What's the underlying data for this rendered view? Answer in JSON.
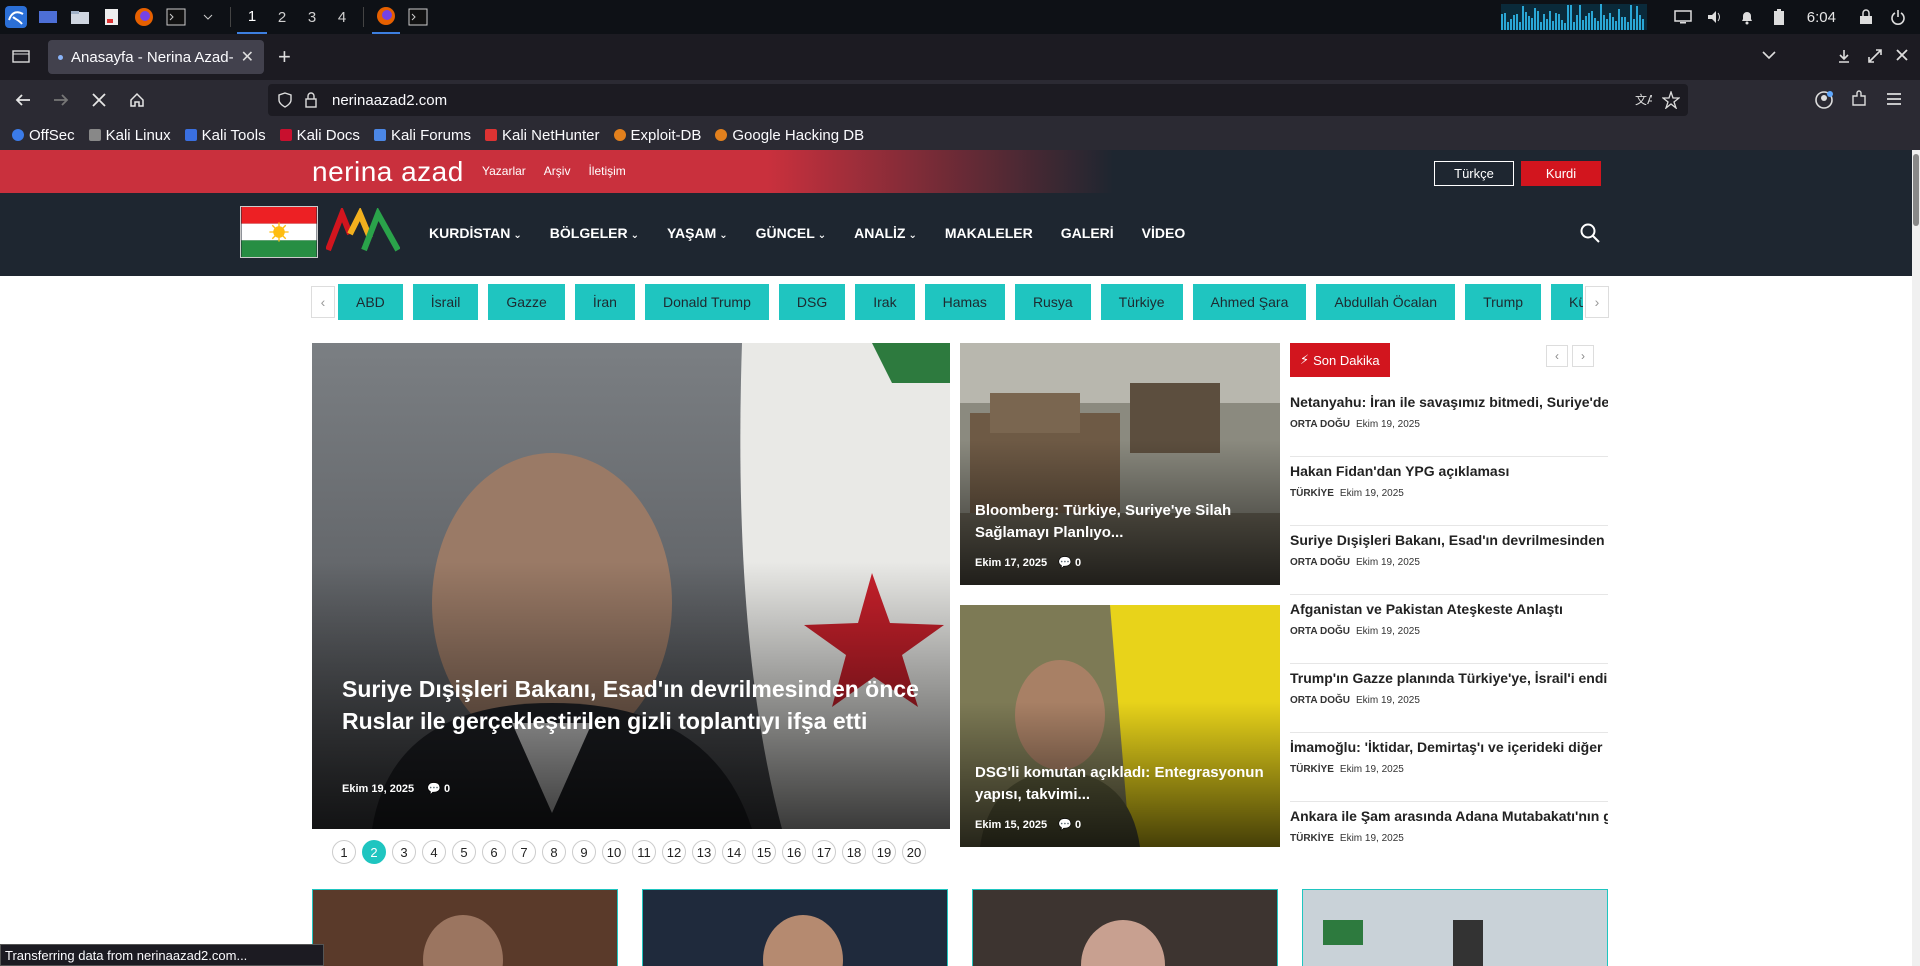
{
  "os": {
    "workspaces": [
      "1",
      "2",
      "3",
      "4"
    ],
    "active_workspace": "1",
    "clock": "6:04"
  },
  "browser": {
    "tab_title": "Anasayfa - Nerina Azad- T",
    "url": "nerinaazad2.com",
    "bookmarks": [
      "OffSec",
      "Kali Linux",
      "Kali Tools",
      "Kali Docs",
      "Kali Forums",
      "Kali NetHunter",
      "Exploit-DB",
      "Google Hacking DB"
    ],
    "status": "Transferring data from nerinaazad2.com..."
  },
  "site": {
    "logo": "nerina azad",
    "top_links": [
      "Yazarlar",
      "Arşiv",
      "İletişim"
    ],
    "lang_tr": "Türkçe",
    "lang_ku": "Kurdi",
    "menu": [
      {
        "label": "KURDİSTAN",
        "dropdown": true
      },
      {
        "label": "BÖLGELER",
        "dropdown": true
      },
      {
        "label": "YAŞAM",
        "dropdown": true
      },
      {
        "label": "GÜNCEL",
        "dropdown": true
      },
      {
        "label": "ANALİZ",
        "dropdown": true
      },
      {
        "label": "MAKALELER",
        "dropdown": false
      },
      {
        "label": "GALERİ",
        "dropdown": false
      },
      {
        "label": "VİDEO",
        "dropdown": false
      }
    ],
    "tags": [
      "ABD",
      "İsrail",
      "Gazze",
      "İran",
      "Donald Trump",
      "DSG",
      "Irak",
      "Hamas",
      "Rusya",
      "Türkiye",
      "Ahmed Şara",
      "Abdullah Öcalan",
      "Trump",
      "Kürt"
    ],
    "hero": {
      "title": "Suriye Dışişleri Bakanı, Esad'ın devrilmesinden önce Ruslar ile gerçekleştirilen gizli toplantıyı ifşa etti",
      "date": "Ekim 19, 2025",
      "comments": "0"
    },
    "cards": [
      {
        "title": "Bloomberg: Türkiye, Suriye'ye Silah Sağlamayı Planlıyo...",
        "date": "Ekim 17, 2025",
        "comments": "0"
      },
      {
        "title": "DSG'li komutan açıkladı: Entegrasyonun yapısı, takvimi...",
        "date": "Ekim 15, 2025",
        "comments": "0"
      }
    ],
    "breaking": {
      "label": "Son Dakika",
      "items": [
        {
          "title": "Netanyahu: İran ile savaşımız bitmedi, Suriye'de",
          "cat": "ORTA DOĞU",
          "date": "Ekim 19, 2025"
        },
        {
          "title": "Hakan Fidan'dan YPG açıklaması",
          "cat": "TÜRKİYE",
          "date": "Ekim 19, 2025"
        },
        {
          "title": "Suriye Dışişleri Bakanı, Esad'ın devrilmesinden ö",
          "cat": "ORTA DOĞU",
          "date": "Ekim 19, 2025"
        },
        {
          "title": "Afganistan ve Pakistan Ateşkeste Anlaştı",
          "cat": "ORTA DOĞU",
          "date": "Ekim 19, 2025"
        },
        {
          "title": "Trump'ın Gazze planında Türkiye'ye, İsrail'i endi",
          "cat": "ORTA DOĞU",
          "date": "Ekim 19, 2025"
        },
        {
          "title": "İmamoğlu: 'İktidar, Demirtaş'ı ve içerideki diğer",
          "cat": "TÜRKİYE",
          "date": "Ekim 19, 2025"
        },
        {
          "title": "Ankara ile Şam arasında Adana Mutabakatı'nın g",
          "cat": "TÜRKİYE",
          "date": "Ekim 19, 2025"
        }
      ]
    },
    "pages": [
      "1",
      "2",
      "3",
      "4",
      "5",
      "6",
      "7",
      "8",
      "9",
      "10",
      "11",
      "12",
      "13",
      "14",
      "15",
      "16",
      "17",
      "18",
      "19",
      "20"
    ],
    "active_page": "2"
  },
  "colors": {
    "accent_teal": "#1fc5c0",
    "brand_red": "#c9303d",
    "kurdi_red": "#d2151e",
    "nav_dark": "#1e2630"
  }
}
